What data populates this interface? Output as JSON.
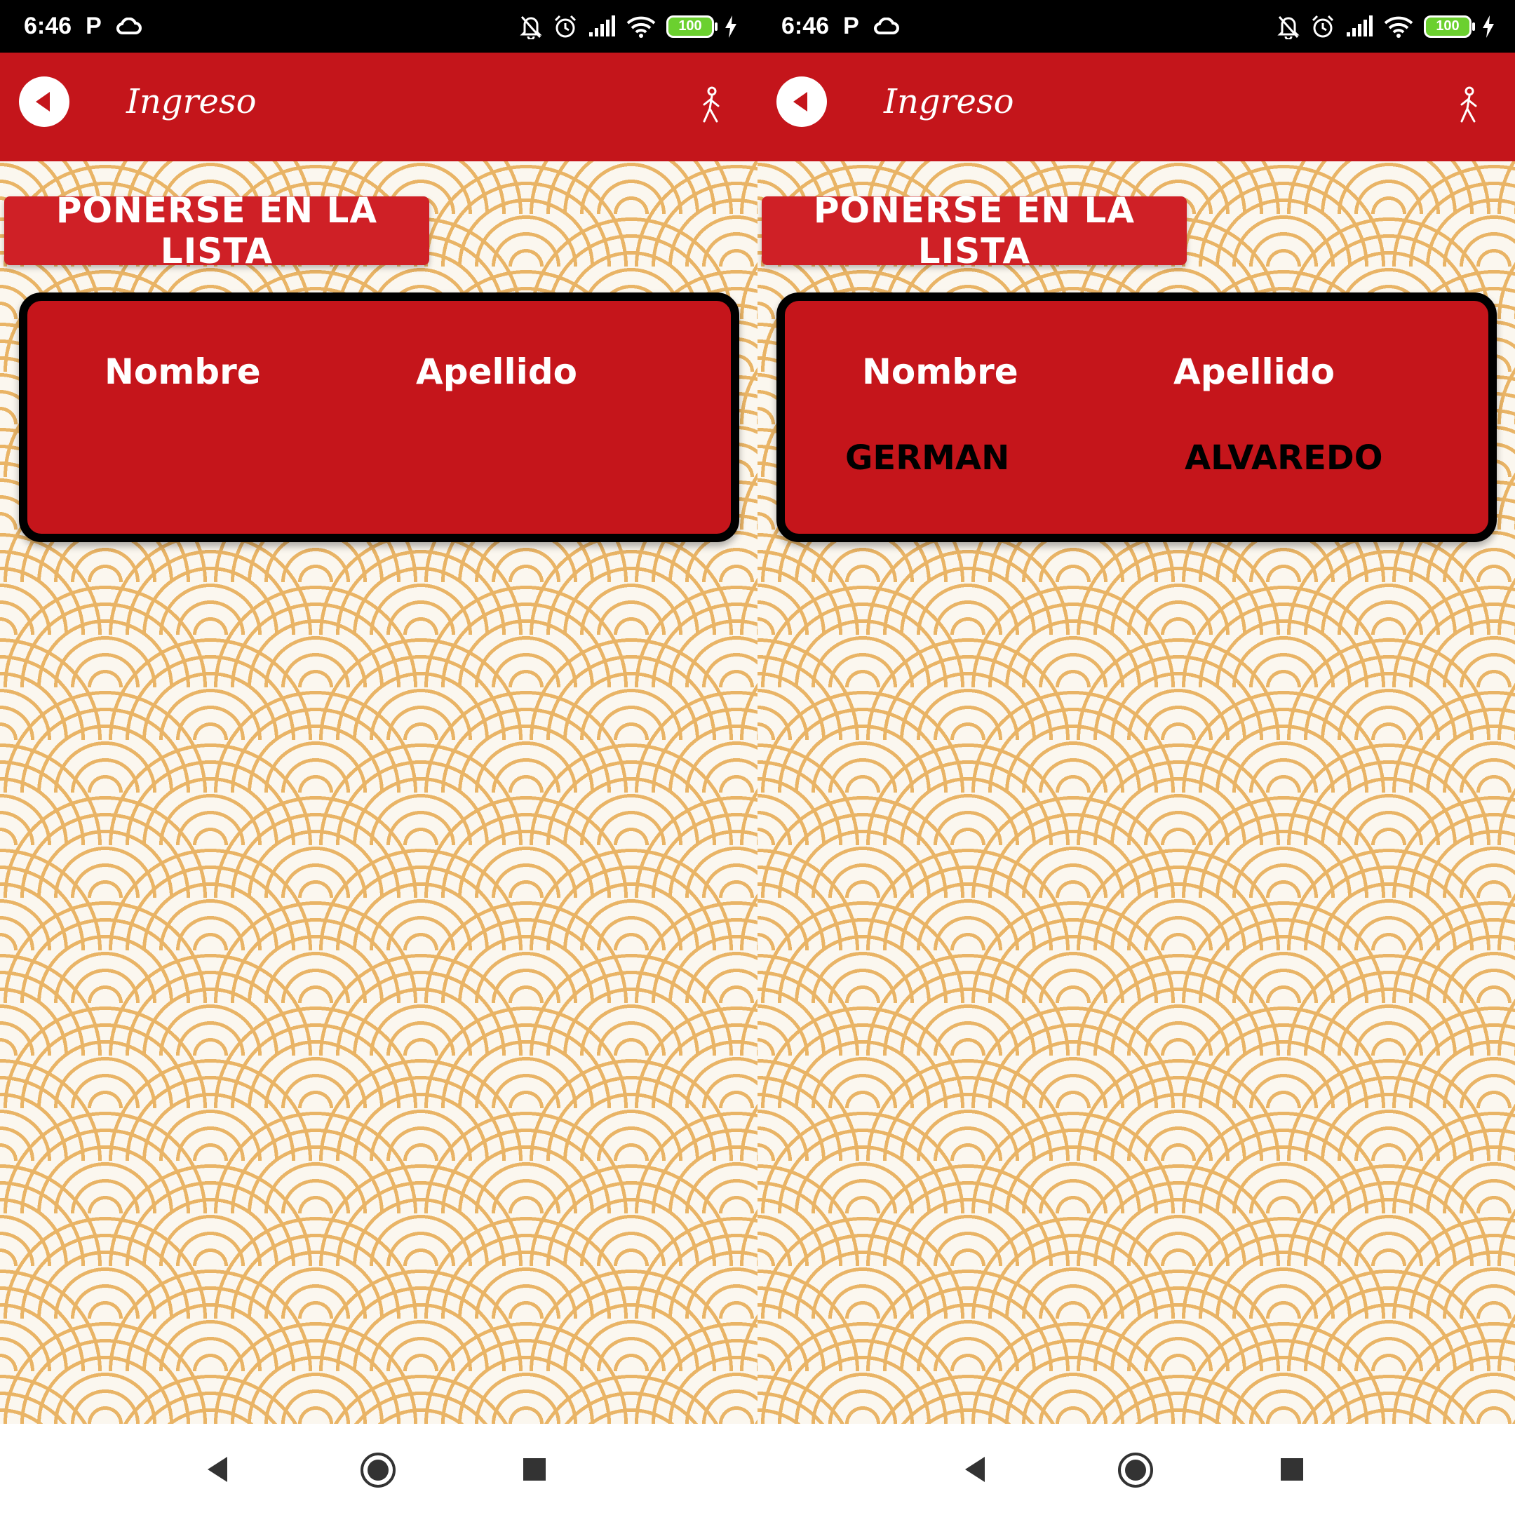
{
  "status_bar": {
    "time": "6:46",
    "indicator": "P",
    "battery": "100"
  },
  "app_bar": {
    "title": "Ingreso"
  },
  "actions": {
    "join_button_label": "PONERSE EN LA LISTA"
  },
  "list": {
    "columns": [
      "Nombre",
      "Apellido"
    ]
  },
  "screens": [
    {
      "rows": []
    },
    {
      "rows": [
        {
          "nombre": "GERMAN",
          "apellido": "ALVAREDO"
        }
      ]
    }
  ],
  "colors": {
    "app_bar": "#c4151b",
    "card": "#c5151b",
    "button": "#cf2026",
    "pattern": "#e9b466",
    "background": "#fbf7ef"
  },
  "icons": {
    "back": "back-arrow-icon",
    "walk": "walking-person-icon",
    "cloud": "cloud-icon",
    "bell_off": "bell-off-icon",
    "alarm": "alarm-clock-icon",
    "signal": "signal-icon",
    "wifi": "wifi-icon",
    "charging": "charging-bolt-icon"
  }
}
